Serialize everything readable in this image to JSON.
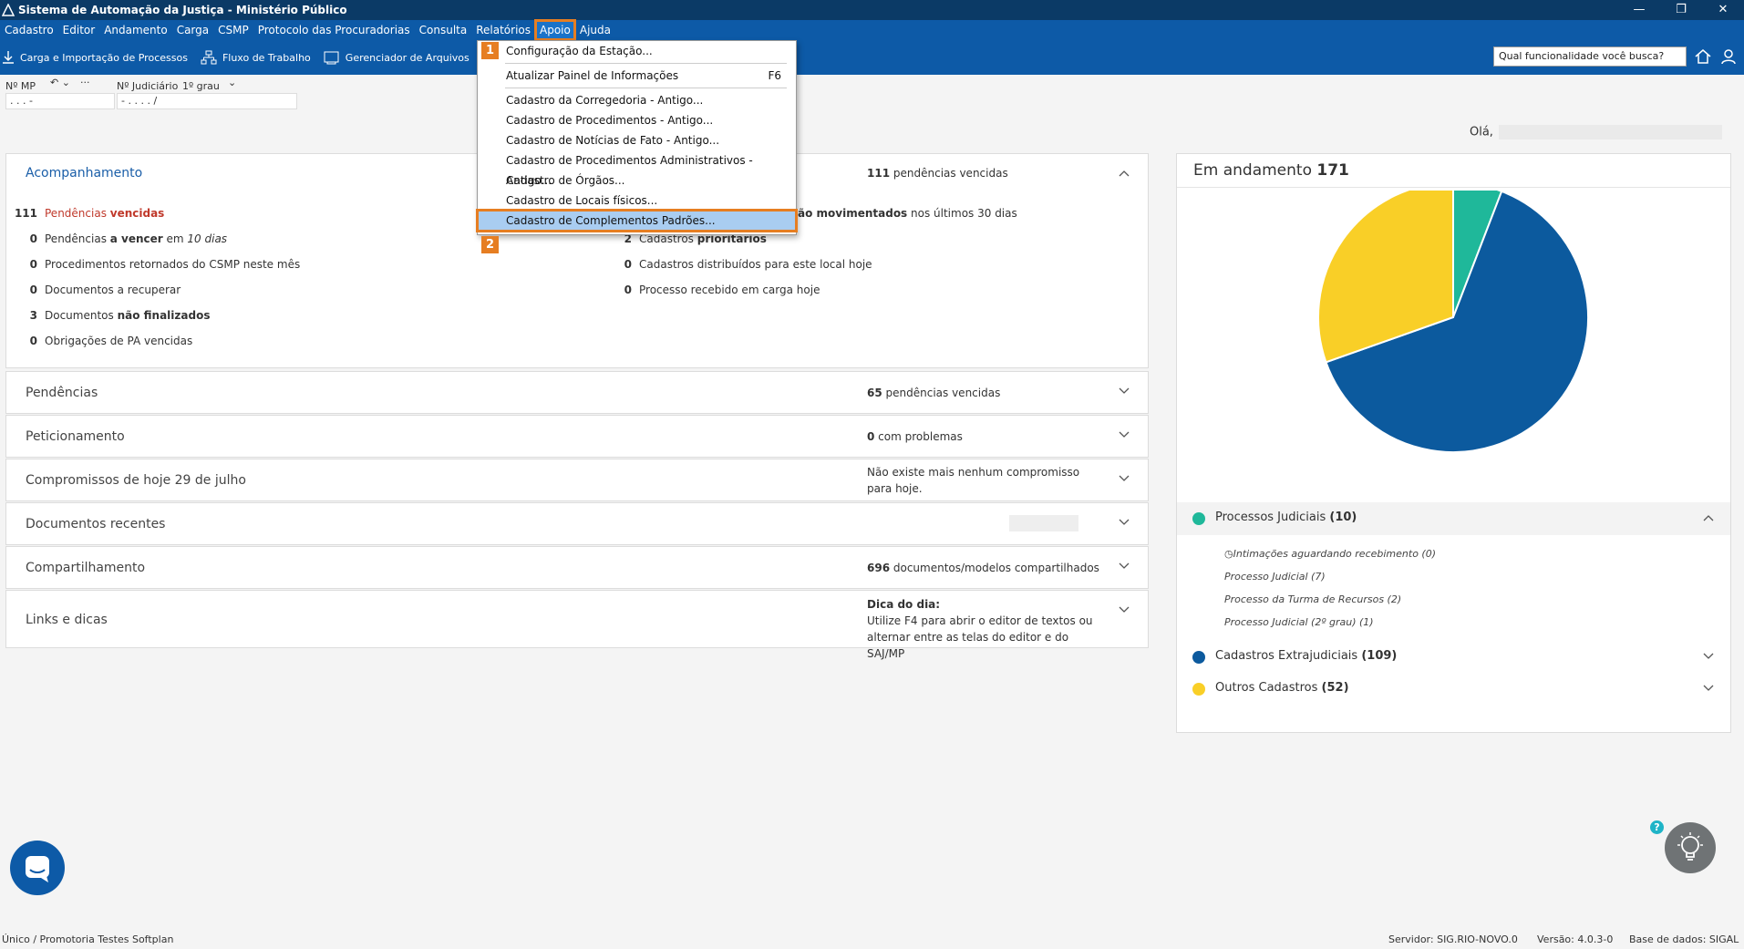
{
  "window": {
    "title": "Sistema de Automação da Justiça - Ministério Público",
    "controls": [
      "—",
      "❐",
      "✕"
    ]
  },
  "menubar": {
    "items": [
      "Cadastro",
      "Editor",
      "Andamento",
      "Carga",
      "CSMP",
      "Protocolo das Procuradorias",
      "Consulta",
      "Relatórios",
      "Apoio",
      "Ajuda"
    ],
    "active": "Apoio"
  },
  "toolbar": {
    "items": [
      "Carga e Importação de Processos",
      "Fluxo de Trabalho",
      "Gerenciador de Arquivos"
    ],
    "search_placeholder": "Qual funcionalidade você busca?"
  },
  "filters": {
    "mp_label": "Nº MP",
    "mp_value": ". . . -",
    "judicial_label": "Nº Judiciário",
    "grau": "1º grau",
    "judicial_value": "- . . . . /",
    "dots": "···"
  },
  "greeting": "Olá,",
  "dropdown": {
    "items": [
      {
        "label": "Configuração da Estação...",
        "shortcut": ""
      },
      {
        "label": "Atualizar Painel de Informações",
        "shortcut": "F6"
      },
      {
        "label": "Cadastro da Corregedoria - Antigo...",
        "shortcut": ""
      },
      {
        "label": "Cadastro de Procedimentos - Antigo...",
        "shortcut": ""
      },
      {
        "label": "Cadastro de Notícias de Fato - Antigo...",
        "shortcut": ""
      },
      {
        "label": "Cadastro de Procedimentos Administrativos - Antigo...",
        "shortcut": ""
      },
      {
        "label": "Cadastro de Órgãos...",
        "shortcut": ""
      },
      {
        "label": "Cadastro de Locais físicos...",
        "shortcut": ""
      },
      {
        "label": "Cadastro de Complementos Padrões...",
        "shortcut": ""
      }
    ],
    "highlighted": "Cadastro de Complementos Padrões...",
    "step1": "1",
    "step2": "2"
  },
  "acompanhamento": {
    "title": "Acompanhamento",
    "header_count": "111",
    "header_text": "pendências vencidas",
    "left": [
      {
        "n": "111",
        "pre": "Pendências ",
        "bold": "vencidas",
        "post": "",
        "red": true
      },
      {
        "n": "0",
        "pre": "Pendências ",
        "bold": "a vencer",
        "post": " em ",
        "ital": "10 dias"
      },
      {
        "n": "0",
        "pre": "Procedimentos retornados do CSMP neste mês",
        "bold": "",
        "post": ""
      },
      {
        "n": "0",
        "pre": "Documentos a recuperar",
        "bold": "",
        "post": ""
      },
      {
        "n": "3",
        "pre": "Documentos ",
        "bold": "não finalizados",
        "post": ""
      },
      {
        "n": "0",
        "pre": "Obrigações de PA vencidas",
        "bold": "",
        "post": ""
      }
    ],
    "right": [
      {
        "n": "",
        "pre": "",
        "bold": "ão movimentados",
        "post": " nos últimos 30 dias"
      },
      {
        "n": "2",
        "pre": "Cadastros ",
        "bold": "prioritários",
        "post": ""
      },
      {
        "n": "0",
        "pre": "Cadastros distribuídos para este local hoje",
        "bold": "",
        "post": ""
      },
      {
        "n": "0",
        "pre": "Processo recebido em carga hoje",
        "bold": "",
        "post": ""
      }
    ]
  },
  "panels": [
    {
      "title": "Pendências",
      "n": "65",
      "info": " pendências vencidas",
      "red": true
    },
    {
      "title": "Peticionamento",
      "n": "0",
      "info": " com problemas",
      "red": true
    },
    {
      "title": "Compromissos de hoje 29 de julho",
      "n": "",
      "info": "Não existe mais nenhum compromisso para hoje.",
      "red": false
    },
    {
      "title": "Documentos recentes",
      "n": "",
      "info": "",
      "red": false
    },
    {
      "title": "Compartilhamento",
      "n": "696",
      "info": " documentos/modelos compartilhados",
      "red": false
    },
    {
      "title": "Links e dicas",
      "n": "Dica do dia:",
      "info": "Utilize F4 para abrir o editor de textos ou alternar entre as telas do editor e do SAJ/MP",
      "red": false
    }
  ],
  "chart_data": {
    "type": "pie",
    "title": "Em andamento",
    "total": "171",
    "categories": [
      "Processos Judiciais",
      "Cadastros Extrajudiciais",
      "Outros Cadastros"
    ],
    "values": [
      10,
      109,
      52
    ],
    "colors": [
      "#1fb89a",
      "#0c5a9e",
      "#f9cf27"
    ]
  },
  "legend": {
    "sections": [
      {
        "label": "Processos Judiciais",
        "count": "(10)",
        "color": "#1fb89a"
      },
      {
        "label": "Cadastros Extrajudiciais",
        "count": "(109)",
        "color": "#0c5a9e"
      },
      {
        "label": "Outros Cadastros",
        "count": "(52)",
        "color": "#f9cf27"
      }
    ],
    "subitems": [
      "Intimações aguardando recebimento (0)",
      "Processo Judicial (7)",
      "Processo da Turma de Recursos (2)",
      "Processo Judicial (2º grau) (1)"
    ]
  },
  "footer": {
    "left": "Único / Promotoria Testes Softplan",
    "server": "Servidor: SIG.RIO-NOVO.0",
    "version": "Versão: 4.0.3-0",
    "db": "Base de dados: SIGAL"
  },
  "help_q": "?"
}
